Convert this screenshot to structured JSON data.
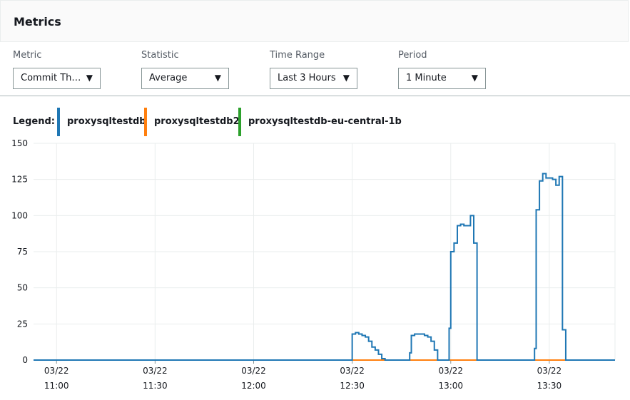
{
  "header": {
    "title": "Metrics"
  },
  "controls": {
    "metric": {
      "label": "Metric",
      "value": "Commit Th…"
    },
    "statistic": {
      "label": "Statistic",
      "value": "Average"
    },
    "time_range": {
      "label": "Time Range",
      "value": "Last 3 Hours"
    },
    "period": {
      "label": "Period",
      "value": "1 Minute"
    }
  },
  "legend": {
    "label": "Legend:",
    "items": [
      {
        "name": "proxysqltestdb",
        "color": "#1f77b4"
      },
      {
        "name": "proxysqltestdb2",
        "color": "#ff7f0e"
      },
      {
        "name": "proxysqltestdb-eu-central-1b",
        "color": "#2ca02c"
      }
    ]
  },
  "chart_data": {
    "type": "line",
    "ylim": [
      0,
      150
    ],
    "yticks": [
      0,
      25,
      50,
      75,
      100,
      125,
      150
    ],
    "xticks": [
      {
        "date": "03/22",
        "time": "11:00",
        "minute": 660
      },
      {
        "date": "03/22",
        "time": "11:30",
        "minute": 690
      },
      {
        "date": "03/22",
        "time": "12:00",
        "minute": 720
      },
      {
        "date": "03/22",
        "time": "12:30",
        "minute": 750
      },
      {
        "date": "03/22",
        "time": "13:00",
        "minute": 780
      },
      {
        "date": "03/22",
        "time": "13:30",
        "minute": 810
      }
    ],
    "xlim": [
      653,
      830
    ],
    "grid": true,
    "series": [
      {
        "name": "proxysqltestdb",
        "color": "#1f77b4",
        "step": true,
        "points": [
          [
            653,
            0
          ],
          [
            749,
            0
          ],
          [
            750,
            18
          ],
          [
            751,
            19
          ],
          [
            752,
            18
          ],
          [
            753,
            17
          ],
          [
            754,
            16
          ],
          [
            755,
            13
          ],
          [
            756,
            9
          ],
          [
            757,
            7
          ],
          [
            758,
            4
          ],
          [
            759,
            1
          ],
          [
            760,
            0
          ],
          [
            767,
            0
          ],
          [
            767.5,
            5
          ],
          [
            768,
            17
          ],
          [
            769,
            18
          ],
          [
            770,
            18
          ],
          [
            771,
            18
          ],
          [
            772,
            17
          ],
          [
            773,
            16
          ],
          [
            774,
            13
          ],
          [
            775,
            7
          ],
          [
            776,
            0
          ],
          [
            779,
            0
          ],
          [
            779.5,
            22
          ],
          [
            780,
            75
          ],
          [
            781,
            81
          ],
          [
            782,
            93
          ],
          [
            783,
            94
          ],
          [
            784,
            93
          ],
          [
            785,
            93
          ],
          [
            786,
            100
          ],
          [
            787,
            81
          ],
          [
            788,
            0
          ],
          [
            805,
            0
          ],
          [
            805.5,
            8
          ],
          [
            806,
            104
          ],
          [
            807,
            124
          ],
          [
            808,
            129
          ],
          [
            809,
            126
          ],
          [
            810,
            126
          ],
          [
            811,
            125
          ],
          [
            812,
            121
          ],
          [
            813,
            127
          ],
          [
            814,
            21
          ],
          [
            815,
            0
          ],
          [
            830,
            0
          ]
        ]
      },
      {
        "name": "proxysqltestdb2",
        "color": "#ff7f0e",
        "step": true,
        "points": [
          [
            653,
            0
          ],
          [
            830,
            0
          ]
        ]
      },
      {
        "name": "proxysqltestdb-eu-central-1b",
        "color": "#2ca02c",
        "step": true,
        "points": [
          [
            653,
            0
          ],
          [
            830,
            0
          ]
        ]
      }
    ]
  }
}
